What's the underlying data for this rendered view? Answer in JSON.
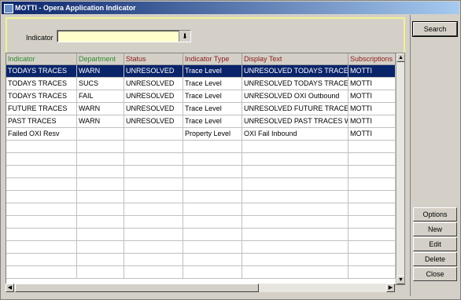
{
  "window": {
    "title": "MOTTI - Opera Application Indicator"
  },
  "filter": {
    "label": "Indicator",
    "value": ""
  },
  "grid": {
    "columns": [
      {
        "label": "Indicator",
        "color": "#2e8b2e"
      },
      {
        "label": "Department",
        "color": "#2e8b2e"
      },
      {
        "label": "Status",
        "color": "#8b1a1a"
      },
      {
        "label": "Indicator Type",
        "color": "#8b1a1a"
      },
      {
        "label": "Display Text",
        "color": "#8b1a1a"
      },
      {
        "label": "Subscriptions",
        "color": "#8b1a1a"
      }
    ],
    "rows": [
      [
        "TODAYS TRACES",
        "WARN",
        "UNRESOLVED",
        "Trace Level",
        "UNRESOLVED TODAYS TRACES",
        "MOTTI"
      ],
      [
        "TODAYS TRACES",
        "SUCS",
        "UNRESOLVED",
        "Trace Level",
        "UNRESOLVED TODAYS TRACES",
        "MOTTI"
      ],
      [
        "TODAYS TRACES",
        "FAIL",
        "UNRESOLVED",
        "Trace Level",
        "UNRESOLVED OXI Outbound",
        "MOTTI"
      ],
      [
        "FUTURE TRACES",
        "WARN",
        "UNRESOLVED",
        "Trace Level",
        "UNRESOLVED FUTURE TRACES",
        "MOTTI"
      ],
      [
        "PAST TRACES",
        "WARN",
        "UNRESOLVED",
        "Trace Level",
        "UNRESOLVED PAST TRACES W",
        "MOTTI"
      ],
      [
        "Failed OXI Resv",
        "",
        "",
        "Property Level",
        "OXI Fail Inbound",
        "MOTTI"
      ]
    ],
    "selected_row": 0
  },
  "buttons": {
    "search": "Search",
    "options": "Options",
    "new": "New",
    "edit": "Edit",
    "delete": "Delete",
    "close": "Close"
  }
}
